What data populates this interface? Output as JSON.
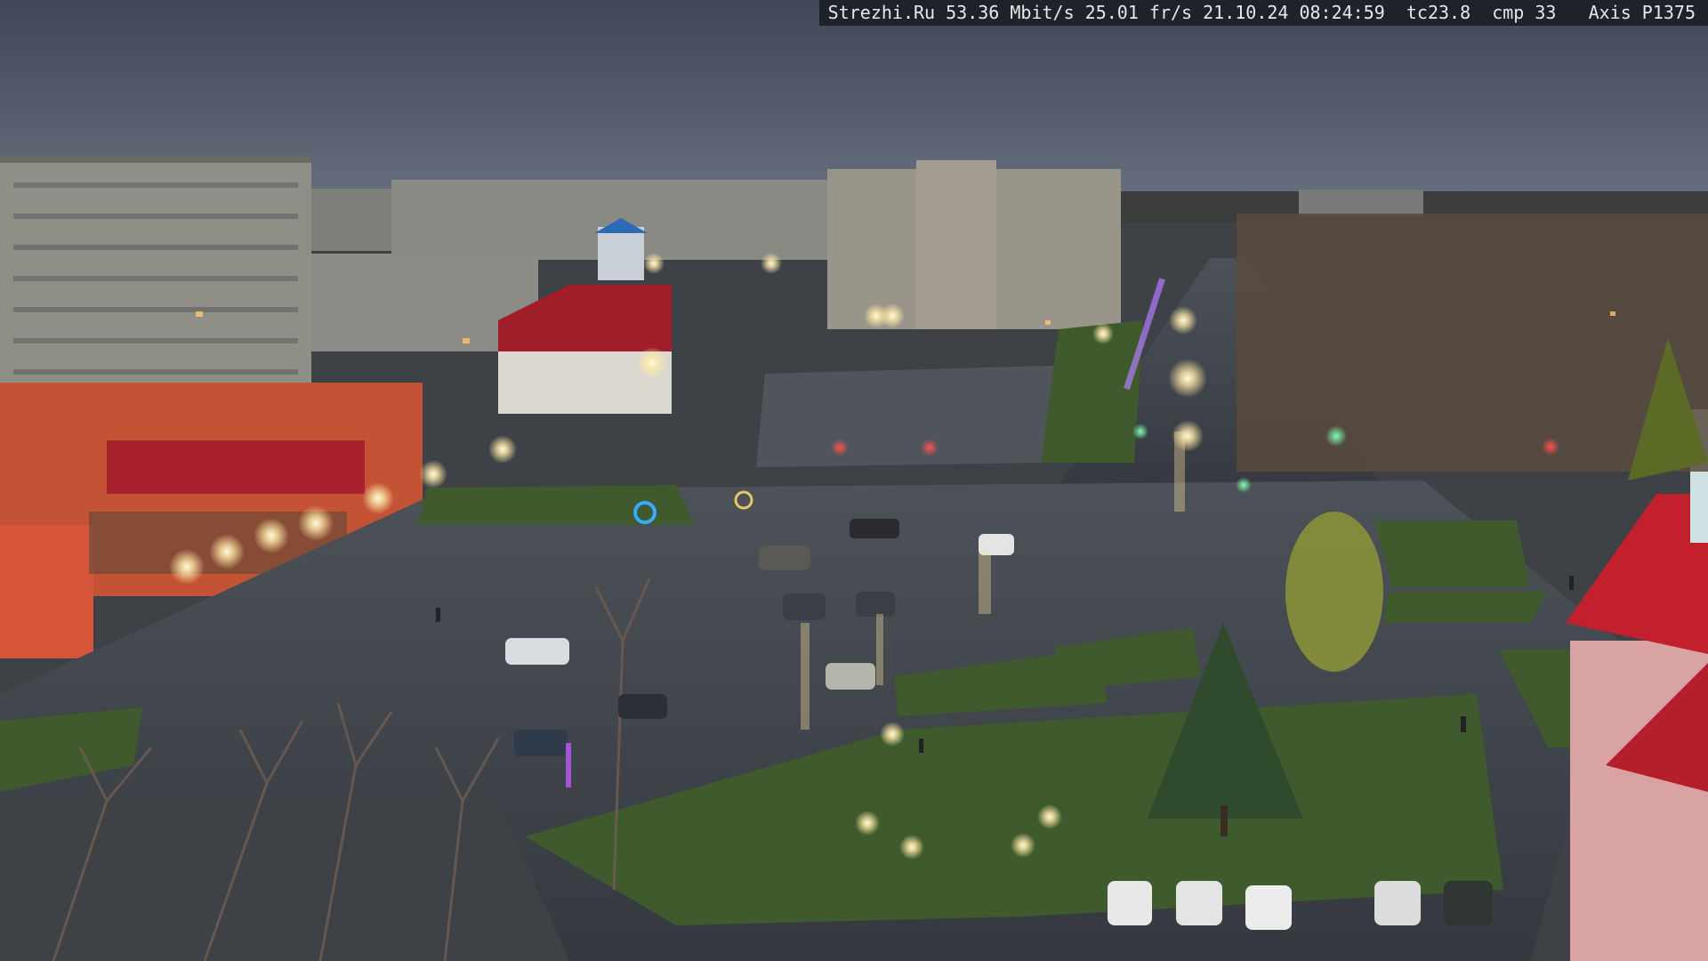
{
  "overlay": {
    "text": "Strezhi.Ru 53.36 Mbit/s 25.01 fr/s 21.10.24 08:24:59  tc23.8  cmp 33   Axis P1375"
  },
  "colors": {
    "sky": "#4c5566",
    "wet_asphalt": "#3d4147",
    "lawn": "#3f5a2c",
    "panel_building": "#8f8f88",
    "shop_facade": "#d0563a",
    "red_roof": "#c3202e",
    "lamp_glow": "#fff2c8",
    "osd_bg": "#1e2229"
  },
  "scene": {
    "description_icons": [
      "overcast-sky",
      "apartment-blocks",
      "wet-intersection",
      "street-lamps",
      "parked-cars",
      "birch-trees"
    ]
  }
}
